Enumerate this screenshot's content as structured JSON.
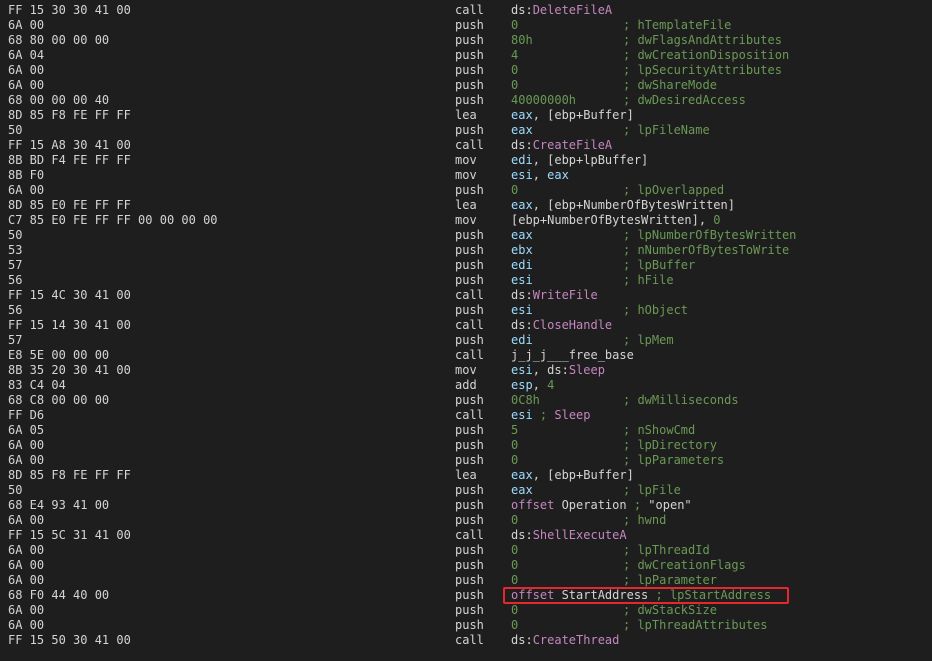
{
  "disassembly": [
    {
      "bytes": "FF 15 30 30 41 00",
      "mnemonic": "call",
      "tokens": [
        {
          "t": "ds:",
          "c": "ds"
        },
        {
          "t": "DeleteFileA",
          "c": "api"
        }
      ]
    },
    {
      "bytes": "6A 00",
      "mnemonic": "push",
      "tokens": [
        {
          "t": "0",
          "c": "num"
        }
      ],
      "comment": "; hTemplateFile"
    },
    {
      "bytes": "68 80 00 00 00",
      "mnemonic": "push",
      "tokens": [
        {
          "t": "80h",
          "c": "num"
        }
      ],
      "comment": "; dwFlagsAndAttributes"
    },
    {
      "bytes": "6A 04",
      "mnemonic": "push",
      "tokens": [
        {
          "t": "4",
          "c": "num"
        }
      ],
      "comment": "; dwCreationDisposition"
    },
    {
      "bytes": "6A 00",
      "mnemonic": "push",
      "tokens": [
        {
          "t": "0",
          "c": "num"
        }
      ],
      "comment": "; lpSecurityAttributes"
    },
    {
      "bytes": "6A 00",
      "mnemonic": "push",
      "tokens": [
        {
          "t": "0",
          "c": "num"
        }
      ],
      "comment": "; dwShareMode"
    },
    {
      "bytes": "68 00 00 00 40",
      "mnemonic": "push",
      "tokens": [
        {
          "t": "40000000h",
          "c": "num"
        }
      ],
      "comment": "; dwDesiredAccess"
    },
    {
      "bytes": "8D 85 F8 FE FF FF",
      "mnemonic": "lea",
      "tokens": [
        {
          "t": "eax",
          "c": "reg"
        },
        {
          "t": ", [ebp+Buffer]",
          "c": "pl"
        }
      ]
    },
    {
      "bytes": "50",
      "mnemonic": "push",
      "tokens": [
        {
          "t": "eax",
          "c": "reg"
        }
      ],
      "comment": "; lpFileName"
    },
    {
      "bytes": "FF 15 A8 30 41 00",
      "mnemonic": "call",
      "tokens": [
        {
          "t": "ds:",
          "c": "ds"
        },
        {
          "t": "CreateFileA",
          "c": "api"
        }
      ]
    },
    {
      "bytes": "8B BD F4 FE FF FF",
      "mnemonic": "mov",
      "tokens": [
        {
          "t": "edi",
          "c": "reg"
        },
        {
          "t": ", [ebp+lpBuffer]",
          "c": "pl"
        }
      ]
    },
    {
      "bytes": "8B F0",
      "mnemonic": "mov",
      "tokens": [
        {
          "t": "esi",
          "c": "reg"
        },
        {
          "t": ", ",
          "c": "pl"
        },
        {
          "t": "eax",
          "c": "reg"
        }
      ]
    },
    {
      "bytes": "6A 00",
      "mnemonic": "push",
      "tokens": [
        {
          "t": "0",
          "c": "num"
        }
      ],
      "comment": "; lpOverlapped"
    },
    {
      "bytes": "8D 85 E0 FE FF FF",
      "mnemonic": "lea",
      "tokens": [
        {
          "t": "eax",
          "c": "reg"
        },
        {
          "t": ", [ebp+NumberOfBytesWritten]",
          "c": "pl"
        }
      ]
    },
    {
      "bytes": "C7 85 E0 FE FF FF 00 00 00 00",
      "mnemonic": "mov",
      "tokens": [
        {
          "t": "[ebp+NumberOfBytesWritten], ",
          "c": "pl"
        },
        {
          "t": "0",
          "c": "num"
        }
      ]
    },
    {
      "bytes": "50",
      "mnemonic": "push",
      "tokens": [
        {
          "t": "eax",
          "c": "reg"
        }
      ],
      "comment": "; lpNumberOfBytesWritten"
    },
    {
      "bytes": "53",
      "mnemonic": "push",
      "tokens": [
        {
          "t": "ebx",
          "c": "reg"
        }
      ],
      "comment": "; nNumberOfBytesToWrite"
    },
    {
      "bytes": "57",
      "mnemonic": "push",
      "tokens": [
        {
          "t": "edi",
          "c": "reg"
        }
      ],
      "comment": "; lpBuffer"
    },
    {
      "bytes": "56",
      "mnemonic": "push",
      "tokens": [
        {
          "t": "esi",
          "c": "reg"
        }
      ],
      "comment": "; hFile"
    },
    {
      "bytes": "FF 15 4C 30 41 00",
      "mnemonic": "call",
      "tokens": [
        {
          "t": "ds:",
          "c": "ds"
        },
        {
          "t": "WriteFile",
          "c": "api"
        }
      ]
    },
    {
      "bytes": "56",
      "mnemonic": "push",
      "tokens": [
        {
          "t": "esi",
          "c": "reg"
        }
      ],
      "comment": "; hObject"
    },
    {
      "bytes": "FF 15 14 30 41 00",
      "mnemonic": "call",
      "tokens": [
        {
          "t": "ds:",
          "c": "ds"
        },
        {
          "t": "CloseHandle",
          "c": "api"
        }
      ]
    },
    {
      "bytes": "57",
      "mnemonic": "push",
      "tokens": [
        {
          "t": "edi",
          "c": "reg"
        }
      ],
      "comment": "; lpMem"
    },
    {
      "bytes": "E8 5E 00 00 00",
      "mnemonic": "call",
      "tokens": [
        {
          "t": "j_j_j___free_base",
          "c": "pl"
        }
      ]
    },
    {
      "bytes": "8B 35 20 30 41 00",
      "mnemonic": "mov",
      "tokens": [
        {
          "t": "esi",
          "c": "reg"
        },
        {
          "t": ", ds:",
          "c": "pl"
        },
        {
          "t": "Sleep",
          "c": "api"
        }
      ]
    },
    {
      "bytes": "83 C4 04",
      "mnemonic": "add",
      "tokens": [
        {
          "t": "esp",
          "c": "reg"
        },
        {
          "t": ", ",
          "c": "pl"
        },
        {
          "t": "4",
          "c": "num"
        }
      ]
    },
    {
      "bytes": "68 C8 00 00 00",
      "mnemonic": "push",
      "tokens": [
        {
          "t": "0C8h",
          "c": "num"
        }
      ],
      "comment": "; dwMilliseconds"
    },
    {
      "bytes": "FF D6",
      "mnemonic": "call",
      "tokens": [
        {
          "t": "esi",
          "c": "reg"
        },
        {
          "t": " ; ",
          "c": "cmt"
        },
        {
          "t": "Sleep",
          "c": "api"
        }
      ]
    },
    {
      "bytes": "6A 05",
      "mnemonic": "push",
      "tokens": [
        {
          "t": "5",
          "c": "num"
        }
      ],
      "comment": "; nShowCmd"
    },
    {
      "bytes": "6A 00",
      "mnemonic": "push",
      "tokens": [
        {
          "t": "0",
          "c": "num"
        }
      ],
      "comment": "; lpDirectory"
    },
    {
      "bytes": "6A 00",
      "mnemonic": "push",
      "tokens": [
        {
          "t": "0",
          "c": "num"
        }
      ],
      "comment": "; lpParameters"
    },
    {
      "bytes": "8D 85 F8 FE FF FF",
      "mnemonic": "lea",
      "tokens": [
        {
          "t": "eax",
          "c": "reg"
        },
        {
          "t": ", [ebp+Buffer]",
          "c": "pl"
        }
      ]
    },
    {
      "bytes": "50",
      "mnemonic": "push",
      "tokens": [
        {
          "t": "eax",
          "c": "reg"
        }
      ],
      "comment": "; lpFile"
    },
    {
      "bytes": "68 E4 93 41 00",
      "mnemonic": "push",
      "tokens": [
        {
          "t": "offset ",
          "c": "kw"
        },
        {
          "t": "Operation",
          "c": "var"
        },
        {
          "t": " ; ",
          "c": "cmt"
        },
        {
          "t": "\"open\"",
          "c": "str"
        }
      ]
    },
    {
      "bytes": "6A 00",
      "mnemonic": "push",
      "tokens": [
        {
          "t": "0",
          "c": "num"
        }
      ],
      "comment": "; hwnd"
    },
    {
      "bytes": "FF 15 5C 31 41 00",
      "mnemonic": "call",
      "tokens": [
        {
          "t": "ds:",
          "c": "ds"
        },
        {
          "t": "ShellExecuteA",
          "c": "api"
        }
      ]
    },
    {
      "bytes": "6A 00",
      "mnemonic": "push",
      "tokens": [
        {
          "t": "0",
          "c": "num"
        }
      ],
      "comment": "; lpThreadId"
    },
    {
      "bytes": "6A 00",
      "mnemonic": "push",
      "tokens": [
        {
          "t": "0",
          "c": "num"
        }
      ],
      "comment": "; dwCreationFlags"
    },
    {
      "bytes": "6A 00",
      "mnemonic": "push",
      "tokens": [
        {
          "t": "0",
          "c": "num"
        }
      ],
      "comment": "; lpParameter"
    },
    {
      "bytes": "68 F0 44 40 00",
      "mnemonic": "push",
      "tokens": [
        {
          "t": "offset ",
          "c": "kw"
        },
        {
          "t": "StartAddress",
          "c": "var"
        },
        {
          "t": " ; lpStartAddress",
          "c": "cmt"
        }
      ],
      "highlighted": true
    },
    {
      "bytes": "6A 00",
      "mnemonic": "push",
      "tokens": [
        {
          "t": "0",
          "c": "num"
        }
      ],
      "comment": "; dwStackSize"
    },
    {
      "bytes": "6A 00",
      "mnemonic": "push",
      "tokens": [
        {
          "t": "0",
          "c": "num"
        }
      ],
      "comment": "; lpThreadAttributes"
    },
    {
      "bytes": "FF 15 50 30 41 00",
      "mnemonic": "call",
      "tokens": [
        {
          "t": "ds:",
          "c": "ds"
        },
        {
          "t": "CreateThread",
          "c": "api"
        }
      ]
    }
  ],
  "colors": {
    "background": "#1e1e1e",
    "text": "#d4d4d4",
    "number": "#6a9955",
    "register": "#9cdcfe",
    "api": "#c586c0",
    "comment": "#6a9955",
    "highlight_border": "#e8262e"
  }
}
